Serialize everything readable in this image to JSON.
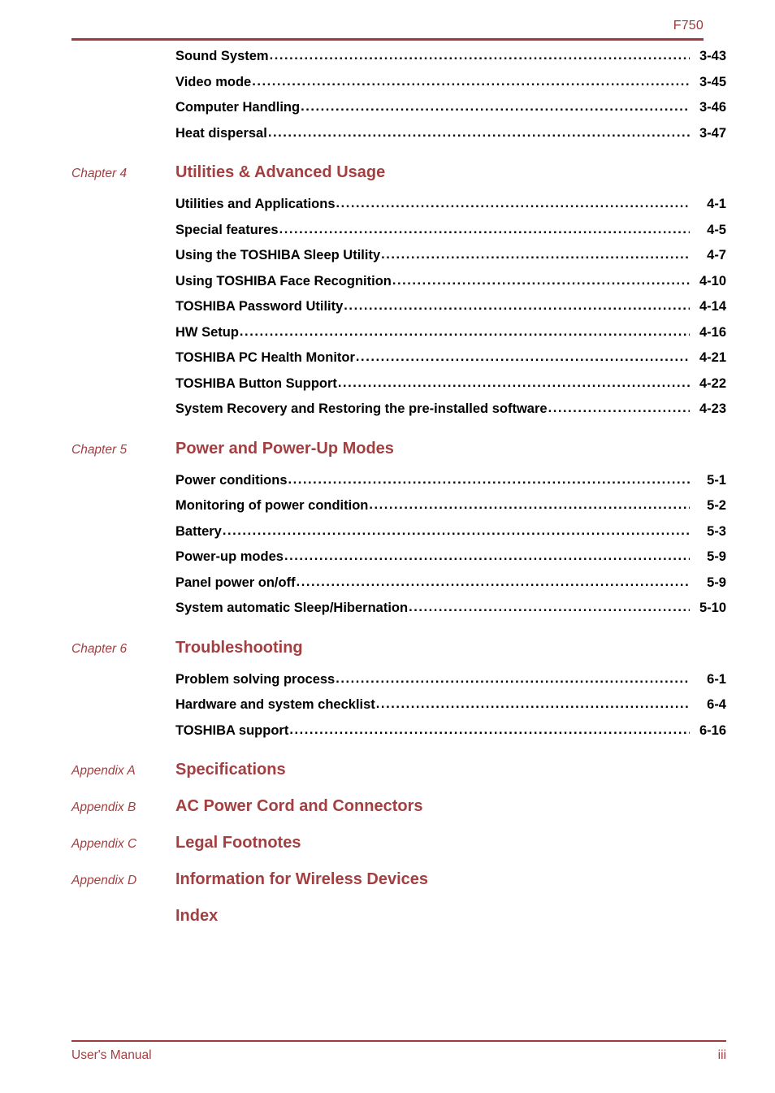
{
  "header": {
    "model": "F750"
  },
  "footer": {
    "left": "User's Manual",
    "page_number": "iii"
  },
  "toc": {
    "groups": [
      {
        "label": "",
        "title": "",
        "entries": [
          {
            "title": "Sound System",
            "page": "3-43"
          },
          {
            "title": "Video mode",
            "page": "3-45"
          },
          {
            "title": "Computer Handling",
            "page": "3-46"
          },
          {
            "title": "Heat dispersal",
            "page": "3-47"
          }
        ]
      },
      {
        "label": "Chapter 4",
        "title": "Utilities & Advanced Usage",
        "entries": [
          {
            "title": "Utilities and Applications",
            "page": "4-1"
          },
          {
            "title": "Special features",
            "page": "4-5"
          },
          {
            "title": "Using the TOSHIBA Sleep Utility",
            "page": "4-7"
          },
          {
            "title": "Using TOSHIBA Face Recognition",
            "page": "4-10"
          },
          {
            "title": "TOSHIBA Password Utility",
            "page": "4-14"
          },
          {
            "title": "HW Setup",
            "page": "4-16"
          },
          {
            "title": "TOSHIBA PC Health Monitor",
            "page": "4-21"
          },
          {
            "title": "TOSHIBA Button Support",
            "page": "4-22"
          },
          {
            "title": "System Recovery and Restoring the pre-installed software",
            "page": "4-23"
          }
        ]
      },
      {
        "label": "Chapter 5",
        "title": "Power and Power-Up Modes",
        "entries": [
          {
            "title": "Power conditions",
            "page": "5-1"
          },
          {
            "title": "Monitoring of power condition",
            "page": "5-2"
          },
          {
            "title": "Battery",
            "page": "5-3"
          },
          {
            "title": "Power-up modes",
            "page": "5-9"
          },
          {
            "title": "Panel power on/off",
            "page": "5-9"
          },
          {
            "title": "System automatic Sleep/Hibernation",
            "page": "5-10"
          }
        ]
      },
      {
        "label": "Chapter 6",
        "title": "Troubleshooting",
        "entries": [
          {
            "title": "Problem solving process",
            "page": "6-1"
          },
          {
            "title": "Hardware and system checklist",
            "page": "6-4"
          },
          {
            "title": "TOSHIBA support",
            "page": "6-16"
          }
        ]
      }
    ],
    "appendices": [
      {
        "label": "Appendix A",
        "title": "Specifications"
      },
      {
        "label": "Appendix B",
        "title": "AC Power Cord and Connectors"
      },
      {
        "label": "Appendix C",
        "title": "Legal Footnotes"
      },
      {
        "label": "Appendix D",
        "title": "Information for Wireless Devices"
      }
    ],
    "index": {
      "label": "",
      "title": "Index"
    }
  },
  "colors": {
    "accent": "#9e3a3c",
    "heading": "#a33f41",
    "text": "#000000"
  }
}
